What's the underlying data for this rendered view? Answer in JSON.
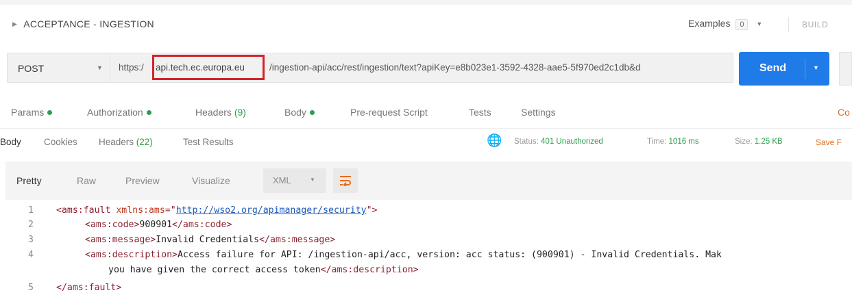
{
  "request": {
    "breadcrumb": "ACCEPTANCE - INGESTION",
    "examples_label": "Examples",
    "examples_count": "0",
    "build_label": "BUILD",
    "method": "POST",
    "url_prefix": "https:/",
    "url_host": "api.tech.ec.europa.eu",
    "url_rest": "/ingestion-api/acc/rest/ingestion/text?apiKey=e8b023e1-3592-4328-aae5-5f970ed2c1db&d",
    "send_label": "Send"
  },
  "request_tabs": {
    "params": "Params",
    "authorization": "Authorization",
    "headers": "Headers",
    "headers_count": "(9)",
    "body": "Body",
    "prerequest": "Pre-request Script",
    "tests": "Tests",
    "settings": "Settings",
    "cookies_cut": "Co"
  },
  "response_tabs": {
    "body": "Body",
    "cookies": "Cookies",
    "headers": "Headers",
    "headers_count": "(22)",
    "test_results": "Test Results",
    "status_label": "Status:",
    "status_value": "401 Unauthorized",
    "time_label": "Time:",
    "time_value": "1016 ms",
    "size_label": "Size:",
    "size_value": "1.25 KB",
    "save_cut": "Save F"
  },
  "format_bar": {
    "pretty": "Pretty",
    "raw": "Raw",
    "preview": "Preview",
    "visualize": "Visualize",
    "language": "XML"
  },
  "code": {
    "line_numbers": [
      "1",
      "2",
      "3",
      "4",
      "5"
    ],
    "l1_open": "<ams:fault ",
    "l1_attr": "xmlns:ams",
    "l1_eq": "=\"",
    "l1_val": "http://wso2.org/apimanager/security",
    "l1_close": "\">",
    "l2_open": "<ams:code>",
    "l2_text": "900901",
    "l2_close": "</ams:code>",
    "l3_open": "<ams:message>",
    "l3_text": "Invalid Credentials",
    "l3_close": "</ams:message>",
    "l4_open": "<ams:description>",
    "l4_text": "Access failure for API: /ingestion-api/acc, version: acc status: (900901) - Invalid Credentials. Mak",
    "l4b_text": "you have given the correct access token",
    "l4b_close": "</ams:description>",
    "l5_close": "</ams:fault>"
  },
  "colors": {
    "accent": "#1f7be8",
    "success": "#2e9e4e",
    "error_box": "#d2232a",
    "save": "#e66b1c"
  },
  "icons": [
    "chevron-right-icon",
    "chevron-down-icon",
    "globe-icon",
    "wrap-lines-icon"
  ]
}
